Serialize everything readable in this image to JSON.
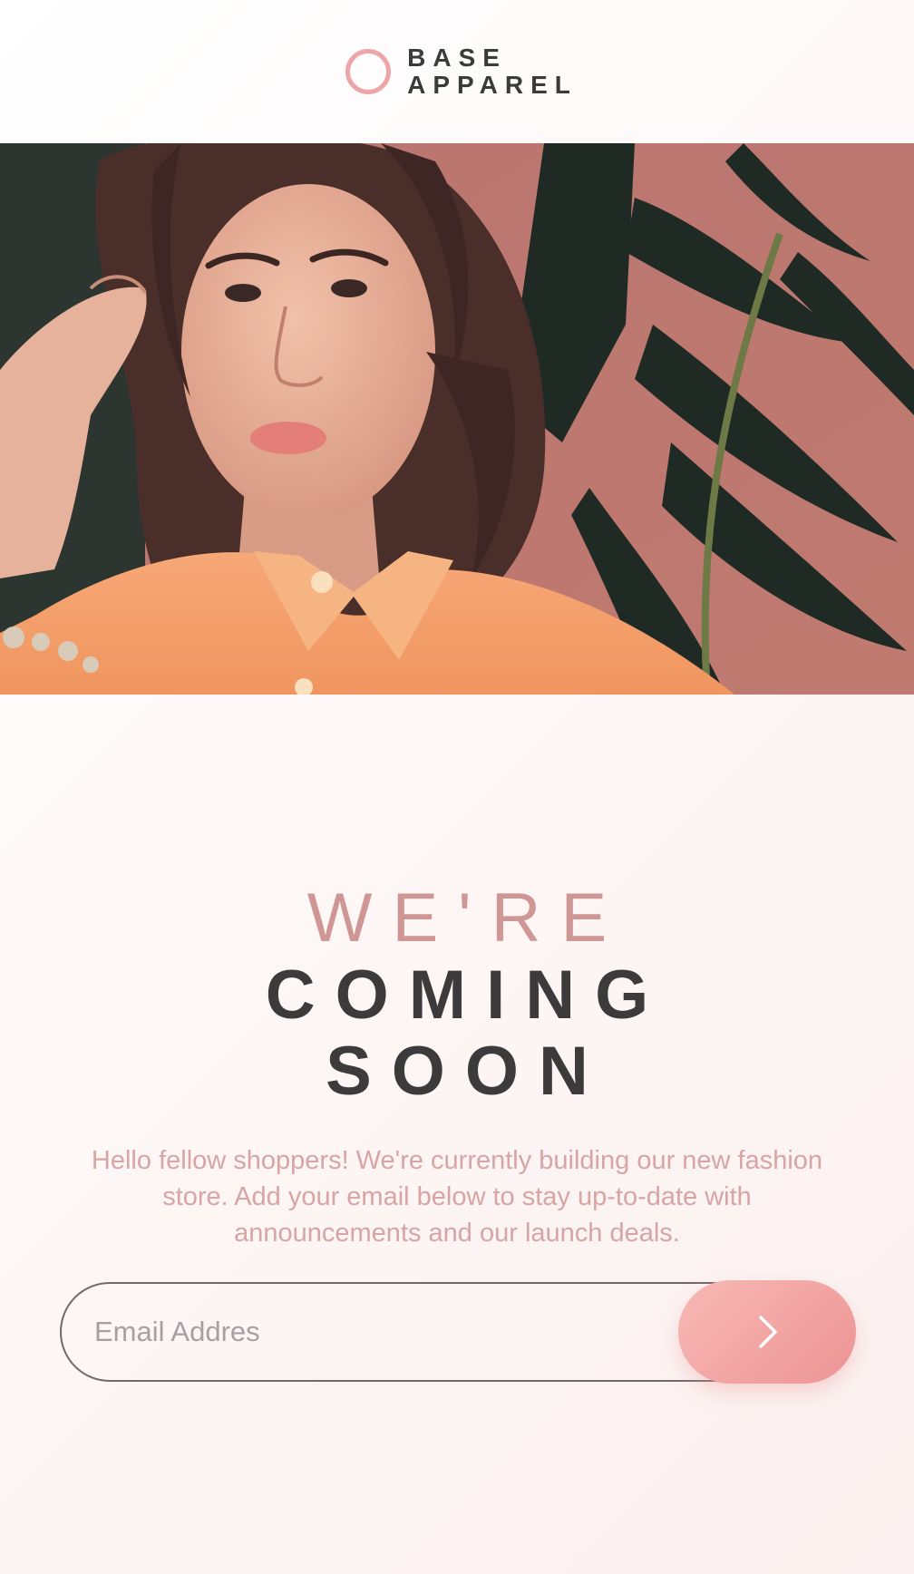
{
  "brand": {
    "line1": "BASE",
    "line2": "APPAREL",
    "accent_color": "#eda6a8",
    "text_color": "#3d3a3c"
  },
  "hero": {
    "image": "woman-in-orange-shirt-photo"
  },
  "headline": {
    "light": "WE'RE",
    "dark_line1": "COMING",
    "dark_line2": "SOON"
  },
  "intro": {
    "text": "Hello fellow shoppers! We're currently building our new fashion store. Add your email below to stay up-to-date with announcements and our launch deals."
  },
  "form": {
    "email_placeholder": "Email Addres",
    "email_value": "",
    "submit_icon": "chevron-right-icon",
    "button_color": "#ec9494"
  }
}
